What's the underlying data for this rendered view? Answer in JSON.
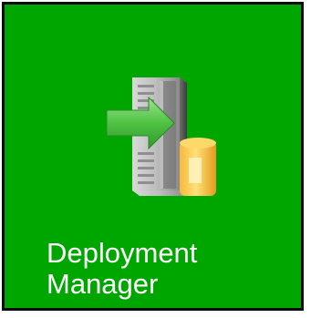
{
  "tile": {
    "label_line1": "Deployment",
    "label_line2": "Manager",
    "background_color": "#00a600",
    "border_color": "#0b0b0b",
    "icon": "server-deploy-icon"
  }
}
